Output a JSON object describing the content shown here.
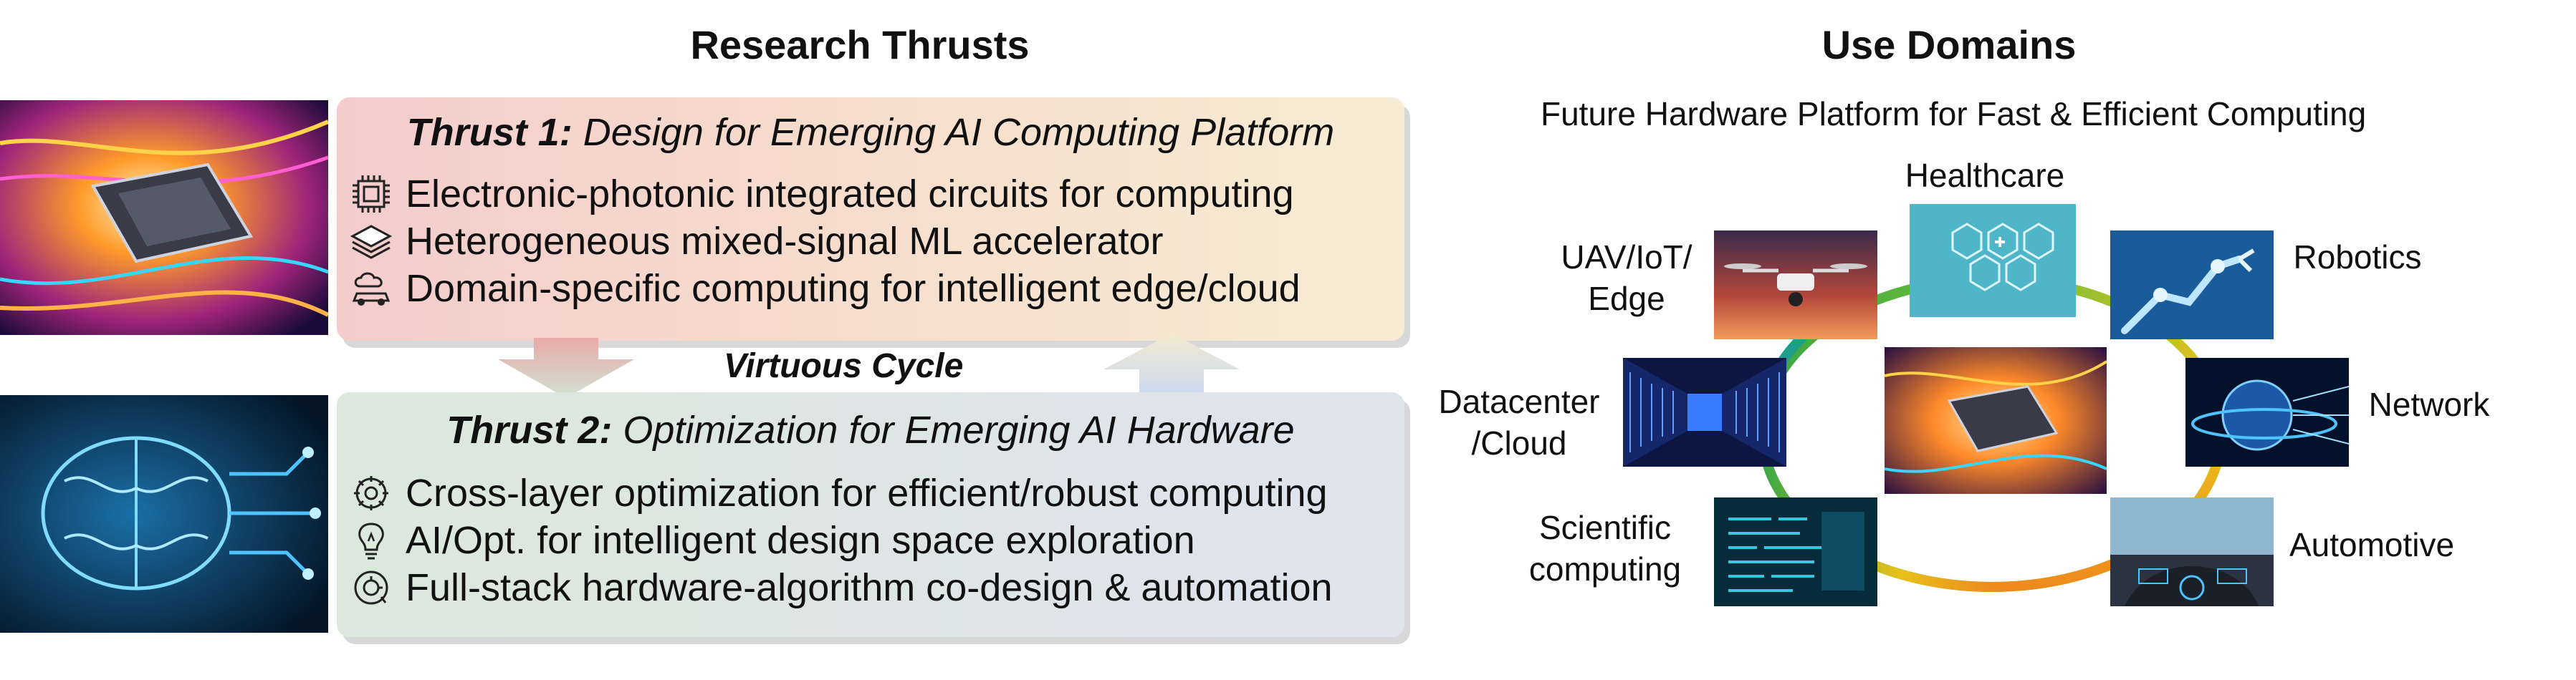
{
  "left": {
    "title": "Research Thrusts",
    "virtuous_cycle": "Virtuous Cycle",
    "thrust1": {
      "label": "Thrust 1:",
      "title": "Design for Emerging AI Computing Platform",
      "items": [
        {
          "text": "Electronic-photonic integrated circuits for computing",
          "icon": "chip-icon"
        },
        {
          "text": "Heterogeneous mixed-signal ML accelerator",
          "icon": "layers-icon"
        },
        {
          "text": "Domain-specific computing for intelligent edge/cloud",
          "icon": "cloud-car-icon"
        }
      ]
    },
    "thrust2": {
      "label": "Thrust 2:",
      "title": "Optimization for Emerging AI Hardware",
      "items": [
        {
          "text": "Cross-layer optimization for efficient/robust computing",
          "icon": "gear-cycle-icon"
        },
        {
          "text": "AI/Opt. for intelligent design space exploration",
          "icon": "lightbulb-icon"
        },
        {
          "text": "Full-stack hardware-algorithm co-design & automation",
          "icon": "automation-icon"
        }
      ]
    }
  },
  "right": {
    "title": "Use Domains",
    "subtitle": "Future Hardware Platform for Fast & Efficient Computing",
    "domains": {
      "healthcare": "Healthcare",
      "uav_line1": "UAV/IoT/",
      "uav_line2": "Edge",
      "robotics": "Robotics",
      "datacenter_line1": "Datacenter",
      "datacenter_line2": "/Cloud",
      "network": "Network",
      "scientific_line1": "Scientific",
      "scientific_line2": "computing",
      "automotive": "Automotive"
    }
  },
  "colors": {
    "thrust1_start": "#f4cccc",
    "thrust1_end": "#f7ecd3",
    "thrust2_start": "#dbe8dc",
    "thrust2_end": "#dfe3ee",
    "ring_green": "#3aa845",
    "ring_yellow": "#e8c11a",
    "ring_orange": "#ee8a1c",
    "ring_blue": "#1f7fd1"
  }
}
